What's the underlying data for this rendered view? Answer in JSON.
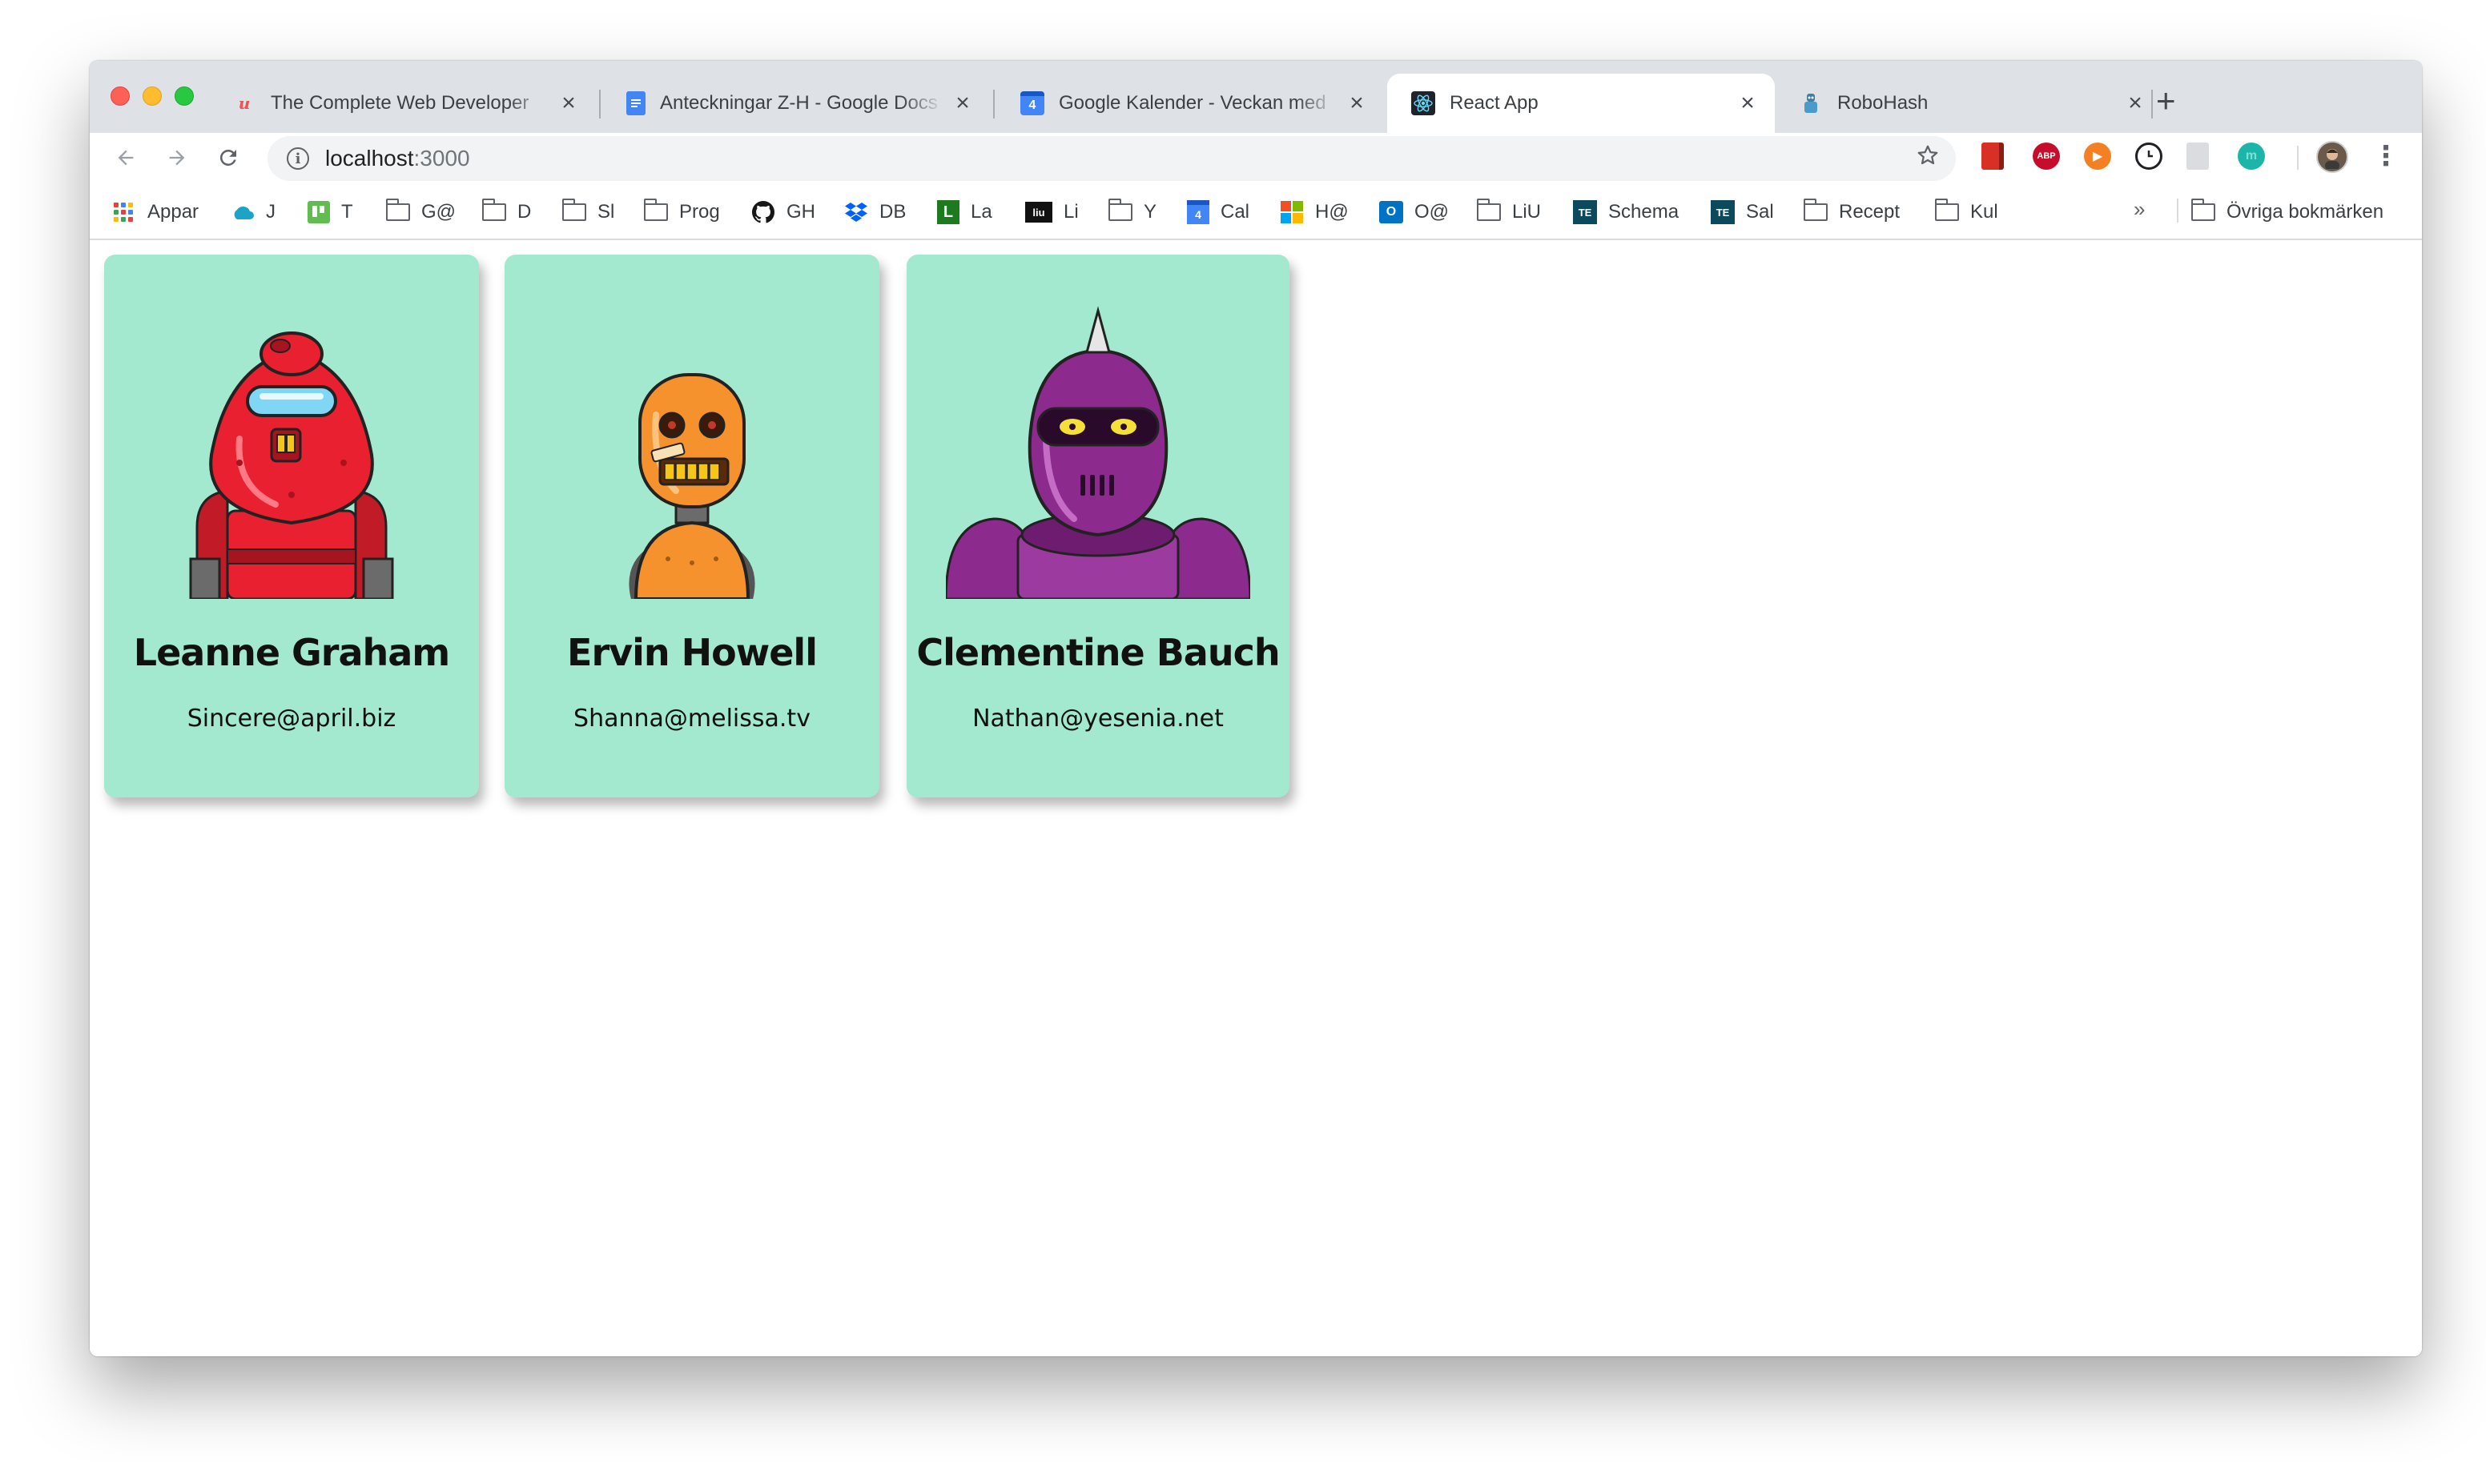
{
  "window": {
    "traffic_lights": [
      "close",
      "minimize",
      "zoom"
    ]
  },
  "tabs": [
    {
      "title": "The Complete Web Developer",
      "favicon": "udemy-icon",
      "active": false
    },
    {
      "title": "Anteckningar Z-H - Google Docs",
      "favicon": "google-docs-icon",
      "active": false
    },
    {
      "title": "Google Kalender - Veckan med",
      "favicon": "google-calendar-icon",
      "favicon_text": "4",
      "active": false
    },
    {
      "title": "React App",
      "favicon": "react-icon",
      "active": true
    },
    {
      "title": "RoboHash",
      "favicon": "robohash-icon",
      "active": false
    }
  ],
  "toolbar": {
    "url_host": "localhost",
    "url_port": ":3000",
    "extensions": [
      {
        "name": "bookmark-ext-icon",
        "color": "#d93025",
        "text": ""
      },
      {
        "name": "adblock-plus-icon",
        "color": "#c70d2c",
        "text": "ABP"
      },
      {
        "name": "play-ext-icon",
        "color": "#f48024",
        "text": "▶"
      },
      {
        "name": "clock-ext-icon",
        "color": "#202124",
        "text": ""
      },
      {
        "name": "clipboard-ext-icon",
        "color": "#bdc1c6",
        "text": ""
      },
      {
        "name": "m-ext-icon",
        "color": "#1bb5a9",
        "text": "m"
      }
    ]
  },
  "bookmarks": [
    {
      "label": "Appar",
      "icon": "apps-grid-icon"
    },
    {
      "label": "J",
      "icon": "cloud-icon",
      "color": "#1ca3c6"
    },
    {
      "label": "T",
      "icon": "trello-icon",
      "color": "#61bd4f"
    },
    {
      "label": "G@",
      "icon": "folder-icon"
    },
    {
      "label": "D",
      "icon": "folder-icon"
    },
    {
      "label": "Sl",
      "icon": "folder-icon"
    },
    {
      "label": "Prog",
      "icon": "folder-icon"
    },
    {
      "label": "GH",
      "icon": "github-icon",
      "color": "#181717"
    },
    {
      "label": "DB",
      "icon": "dropbox-icon",
      "color": "#0061ff"
    },
    {
      "label": "La",
      "icon": "l-logo-icon",
      "color": "#1e7a1e",
      "text": "L"
    },
    {
      "label": "Li",
      "icon": "liu-icon",
      "color": "#111111",
      "text": "liu"
    },
    {
      "label": "Y",
      "icon": "folder-icon"
    },
    {
      "label": "Cal",
      "icon": "google-calendar-icon",
      "color": "#4285f4",
      "text": "4"
    },
    {
      "label": "H@",
      "icon": "microsoft-icon"
    },
    {
      "label": "O@",
      "icon": "outlook-icon",
      "color": "#0072c6",
      "text": "O"
    },
    {
      "label": "LiU",
      "icon": "folder-icon"
    },
    {
      "label": "Schema",
      "icon": "te-icon",
      "color": "#0a4a5c",
      "text": "TE"
    },
    {
      "label": "Sal",
      "icon": "te-icon",
      "color": "#0a4a5c",
      "text": "TE"
    },
    {
      "label": "Recept",
      "icon": "folder-icon"
    },
    {
      "label": "Kul",
      "icon": "folder-icon"
    }
  ],
  "bookmarks_overflow": "»",
  "other_bookmarks": "Övriga bokmärken",
  "robots": [
    {
      "name": "Leanne Graham",
      "email": "Sincere@april.biz",
      "color": "#e8202f",
      "avatar": "red-robot-avatar"
    },
    {
      "name": "Ervin Howell",
      "email": "Shanna@melissa.tv",
      "color": "#f5922d",
      "avatar": "orange-robot-avatar"
    },
    {
      "name": "Clementine Bauch",
      "email": "Nathan@yesenia.net",
      "color": "#8c2a8e",
      "avatar": "purple-robot-avatar"
    }
  ],
  "card_background": "#a2e9cf"
}
